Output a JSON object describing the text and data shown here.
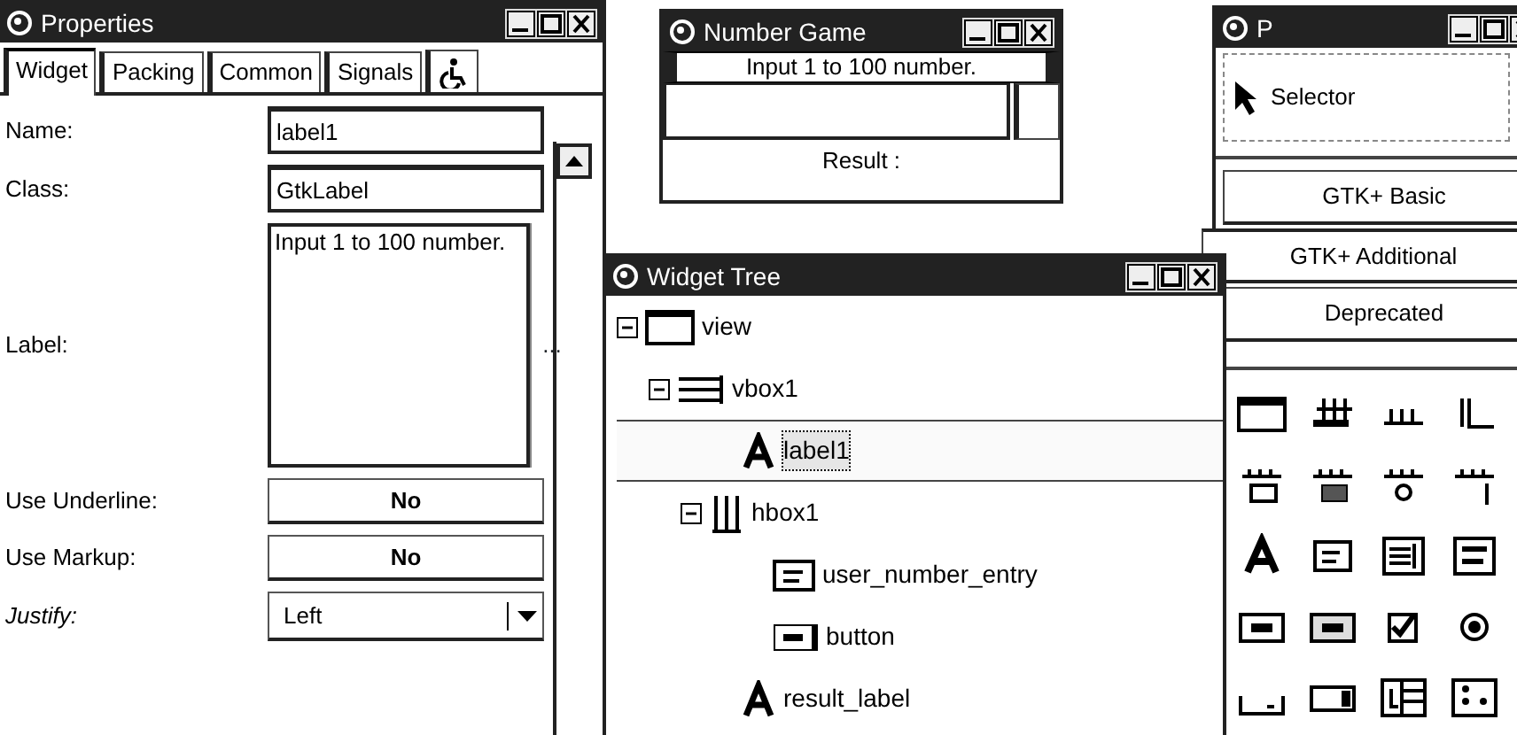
{
  "properties_window": {
    "title": "Properties",
    "tabs": [
      {
        "kind": "text",
        "label": "Widget",
        "selected": true
      },
      {
        "kind": "text",
        "label": "Packing",
        "selected": false
      },
      {
        "kind": "text",
        "label": "Common",
        "selected": false
      },
      {
        "kind": "text",
        "label": "Signals",
        "selected": false
      },
      {
        "kind": "icon",
        "selected": false
      }
    ],
    "rows": [
      {
        "kind": "entry",
        "label": "Name:",
        "value": "label1",
        "italic": false
      },
      {
        "kind": "entry",
        "label": "Class:",
        "value": "GtkLabel",
        "italic": false
      },
      {
        "kind": "text",
        "label": "Label:",
        "value": "Input 1 to 100 number.",
        "button": "...",
        "italic": false
      },
      {
        "kind": "toggle",
        "label": "Use Underline:",
        "value": "No",
        "italic": false
      },
      {
        "kind": "toggle",
        "label": "Use Markup:",
        "value": "No",
        "italic": false
      },
      {
        "kind": "combo",
        "label": "Justify:",
        "value": "Left",
        "italic": true
      }
    ]
  },
  "number_game_window": {
    "title": "Number Game",
    "label": "Input 1 to 100 number.",
    "result": "Result :"
  },
  "palette_window": {
    "title": "P",
    "selector": "Selector",
    "groups": [
      {
        "label": "GTK+ Basic",
        "selected": false
      },
      {
        "label": "GTK+ Additional",
        "selected": true
      },
      {
        "label": "Deprecated",
        "selected": false
      }
    ]
  },
  "widget_tree_window": {
    "title": "Widget Tree",
    "nodes": [
      {
        "kind": "window",
        "name": "view",
        "expanded": true,
        "selected": false,
        "children": [
          {
            "kind": "vbox",
            "name": "vbox1",
            "expanded": true,
            "selected": false,
            "children": [
              {
                "kind": "label",
                "name": "label1",
                "selected": true
              },
              {
                "kind": "hbox",
                "name": "hbox1",
                "expanded": true,
                "selected": false,
                "children": [
                  {
                    "kind": "entry",
                    "name": "user_number_entry",
                    "selected": false
                  },
                  {
                    "kind": "button",
                    "name": "button",
                    "selected": false
                  }
                ]
              },
              {
                "kind": "label",
                "name": "result_label",
                "selected": false
              }
            ]
          }
        ]
      }
    ]
  }
}
